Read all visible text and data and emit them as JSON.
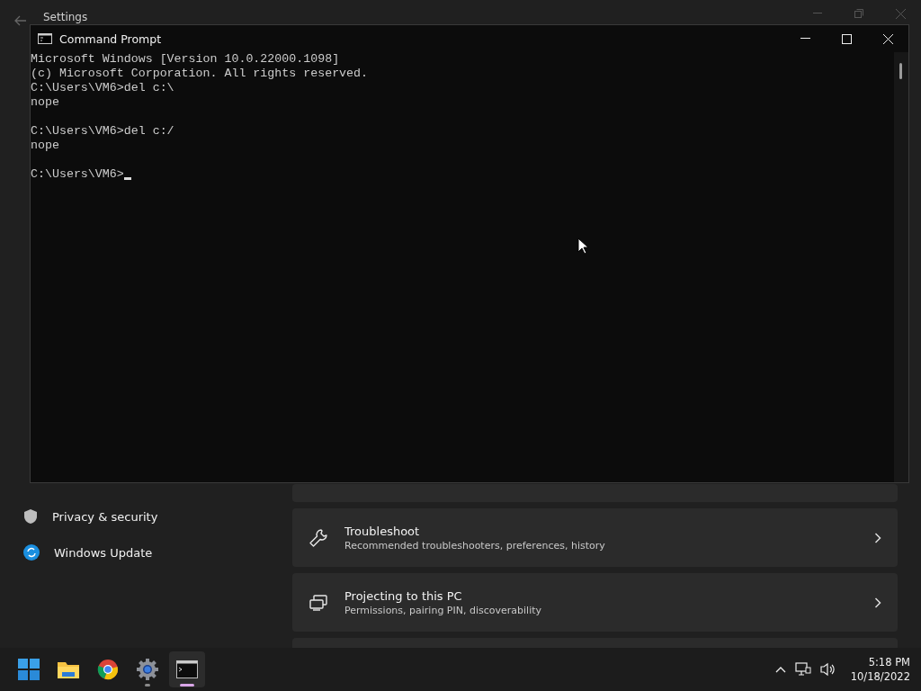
{
  "settings_window": {
    "title": "Settings"
  },
  "sidebar": {
    "items": [
      {
        "label": "Privacy & security"
      },
      {
        "label": "Windows Update"
      }
    ]
  },
  "cards": [
    {
      "kind": "sliver"
    },
    {
      "kind": "link",
      "title": "Troubleshoot",
      "subtitle": "Recommended troubleshooters, preferences, history"
    },
    {
      "kind": "link",
      "title": "Projecting to this PC",
      "subtitle": "Permissions, pairing PIN, discoverability"
    },
    {
      "kind": "edge"
    }
  ],
  "console_window": {
    "title": "Command Prompt"
  },
  "console_lines": [
    {
      "kind": "text",
      "text": "Microsoft Windows [Version 10.0.22000.1098]"
    },
    {
      "kind": "text",
      "text": "(c) Microsoft Corporation. All rights reserved."
    },
    {
      "kind": "text",
      "text": "C:\\Users\\VM6>del c:\\"
    },
    {
      "kind": "text",
      "text": "nope"
    },
    {
      "kind": "blank"
    },
    {
      "kind": "text",
      "text": "C:\\Users\\VM6>del c:/"
    },
    {
      "kind": "text",
      "text": "nope"
    },
    {
      "kind": "blank"
    },
    {
      "kind": "prompt",
      "text": "C:\\Users\\VM6>",
      "cursor": true
    }
  ],
  "taskbar": {
    "apps": [
      {
        "kind": "start",
        "selected": false
      },
      {
        "kind": "explorer",
        "selected": false
      },
      {
        "kind": "chrome",
        "selected": false
      },
      {
        "kind": "settings",
        "selected": false
      },
      {
        "kind": "terminal",
        "selected": true
      }
    ],
    "time": "5:18 PM",
    "date": "10/18/2022"
  }
}
